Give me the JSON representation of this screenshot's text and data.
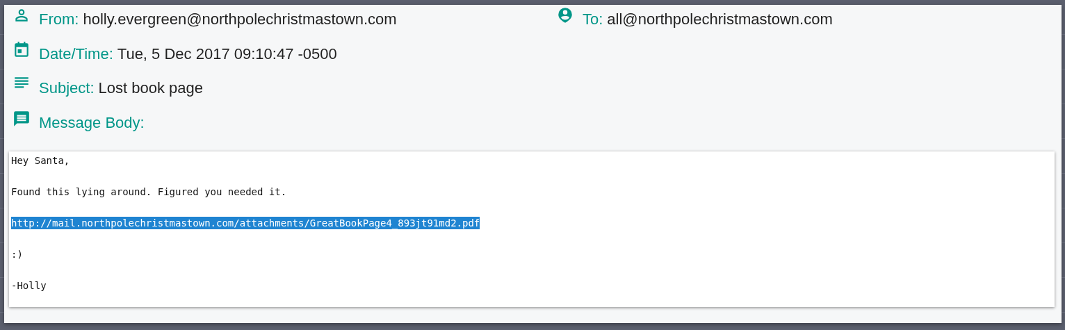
{
  "dialog": {
    "header_rows": [
      [
        {
          "kind": "person",
          "label": "From:",
          "value": "holly.evergreen@northpolechristmastown.com"
        },
        {
          "kind": "account",
          "label": "To:",
          "value": "all@northpolechristmastown.com"
        }
      ],
      [
        {
          "kind": "date",
          "label": "Date/Time:",
          "value": "Tue, 5 Dec 2017 09:10:47 -0500"
        }
      ],
      [
        {
          "kind": "subject",
          "label": "Subject:",
          "value": "Lost book page"
        }
      ],
      [
        {
          "kind": "message",
          "label": "Message Body:"
        }
      ]
    ],
    "message_body": [
      {
        "text": "Hey Santa,",
        "selected": false
      },
      {
        "text": "Found this lying around. Figured you needed it.",
        "selected": false
      },
      {
        "text": "http://mail.northpolechristmastown.com/attachments/GreatBookPage4_893jt91md2.pdf",
        "selected": true
      },
      {
        "text": ":)",
        "selected": false
      },
      {
        "text": "-Holly",
        "selected": false
      }
    ]
  }
}
